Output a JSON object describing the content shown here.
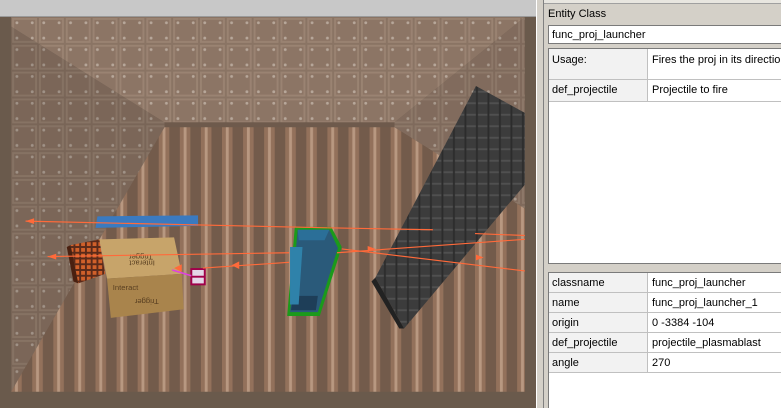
{
  "inspector": {
    "entity_class_label": "Entity Class",
    "class_value": "func_proj_launcher",
    "description": [
      {
        "key": "Usage:",
        "value": "Fires the proj in its direction"
      },
      {
        "key": "def_projectile",
        "value": "Projectile to fire"
      }
    ],
    "properties": [
      {
        "key": "classname",
        "value": "func_proj_launcher"
      },
      {
        "key": "name",
        "value": "func_proj_launcher_1"
      },
      {
        "key": "origin",
        "value": "0 -3384 -104"
      },
      {
        "key": "def_projectile",
        "value": "projectile_plasmablast"
      },
      {
        "key": "angle",
        "value": "270"
      }
    ]
  },
  "viewport": {
    "crate_texture_words": [
      "Trigger",
      "Interact",
      "Interact",
      "Trigger"
    ]
  },
  "colors": {
    "wall": "#7a6656",
    "floor": "#8a7262",
    "selection_line": "#ff6a3a",
    "launcher_outline": "#22cc22",
    "launcher_fill": "#1e4a6a",
    "crate": "#b8945a",
    "pillar": "#3a3a3a"
  }
}
